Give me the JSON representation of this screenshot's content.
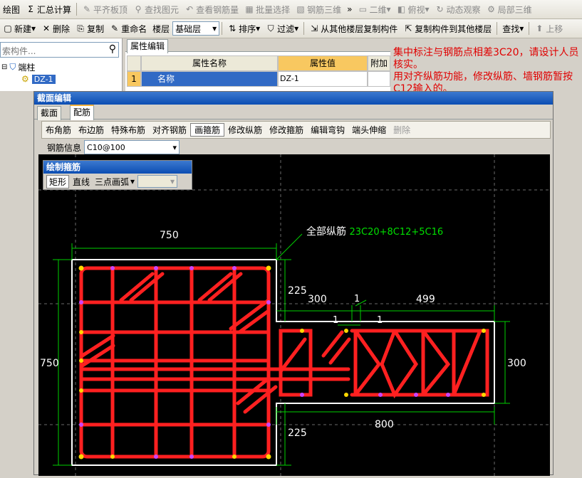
{
  "toolbar1": {
    "items": [
      "绘图",
      "汇总计算",
      "平齐板顶",
      "查找图元",
      "查看钢筋量",
      "批量选择",
      "钢筋三维",
      "»",
      "二维",
      "俯视",
      "动态观察",
      "局部三维"
    ]
  },
  "toolbar2": {
    "new": "新建",
    "delete": "删除",
    "copy": "复制",
    "rename": "重命名",
    "floor_label": "楼层",
    "floor_value": "基础层",
    "sort": "排序",
    "filter": "过滤",
    "copy_from": "从其他楼层复制构件",
    "copy_to": "复制构件到其他楼层",
    "find": "查找",
    "up": "上移"
  },
  "search": {
    "placeholder": "索构件..."
  },
  "tree": {
    "root": "端柱",
    "item": "DZ-1"
  },
  "props": {
    "tab": "属性编辑",
    "col_name": "属性名称",
    "col_value": "属性值",
    "col_extra": "附加",
    "row_num": "1",
    "row_name": "名称",
    "row_value": "DZ-1"
  },
  "note": {
    "line1": "集中标注与钢筋点相差3C20，请设计人员核实。",
    "line2": "用对齐纵筋功能，修改纵筋、墙钢筋暂按C12输入的。"
  },
  "dialog": {
    "title": "截面编辑",
    "tabs": [
      "截面",
      "配筋"
    ],
    "subtools": [
      "布角筋",
      "布边筋",
      "特殊布筋",
      "对齐钢筋",
      "画箍筋",
      "修改纵筋",
      "修改箍筋",
      "编辑弯钩",
      "端头伸缩",
      "删除"
    ],
    "rebar_label": "钢筋信息",
    "rebar_value": "C10@100"
  },
  "draw_panel": {
    "title": "绘制箍筋",
    "tools": [
      "矩形",
      "直线",
      "三点画弧"
    ]
  },
  "drawing": {
    "all_bars_label": "全部纵筋",
    "all_bars_value": "23C20+8C12+5C16",
    "dims": {
      "top": "750",
      "left": "750",
      "d225a": "225",
      "d300": "300",
      "d1a": "1",
      "d499": "499",
      "d1b": "1",
      "d1c": "1",
      "right": "300",
      "bottom": "800",
      "d225b": "225"
    }
  },
  "colors": {
    "rebar": "#ff2020",
    "dim": "#00e000",
    "outline": "#ffffff",
    "note": "#e00000",
    "bar_dot": "#ffd800"
  }
}
